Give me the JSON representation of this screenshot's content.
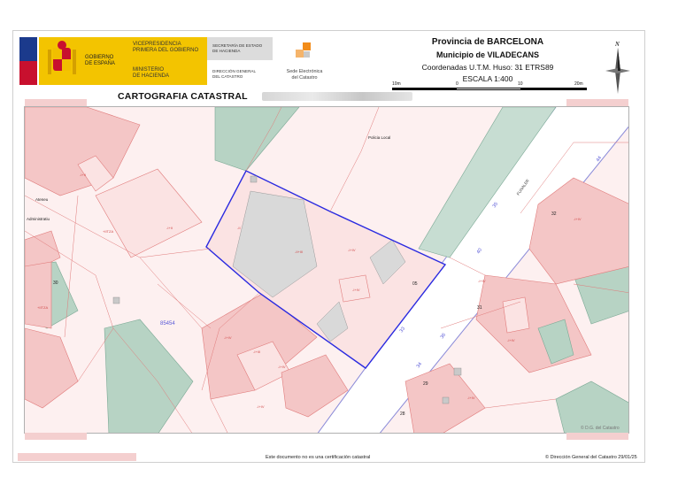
{
  "header": {
    "gov_label": "GOBIERNO\nDE ESPAÑA",
    "vice_label": "VICEPRESIDENCIA\nPRIMERA DEL GOBIERNO",
    "ministry_label": "MINISTERIO\nDE HACIENDA",
    "secretaria_label": "SECRETARÍA DE ESTADO\nDE HACIENDA",
    "direccion_label": "DIRECCIÓN GENERAL\nDEL CATASTRO",
    "sede_label": "Sede Electrónica\ndel Catastro",
    "province": "Provincia de BARCELONA",
    "municipality": "Municipio de VILADECANS",
    "coordinates": "Coordenadas U.T.M. Huso: 31 ETRS89",
    "scale": "ESCALA 1:400",
    "scale_ticks": [
      "10m",
      "0",
      "10",
      "20m"
    ],
    "north_label": "N",
    "map_title": "CARTOGRAFIA CATASTRAL"
  },
  "map": {
    "labels": [
      {
        "text": "Policia Local",
        "kind": "place"
      },
      {
        "text": "Ateneu",
        "kind": "place"
      },
      {
        "text": "Administratiu",
        "kind": "place"
      },
      {
        "text": "85454",
        "kind": "parcel-id"
      },
      {
        "text": "05",
        "kind": "number"
      },
      {
        "text": "30",
        "kind": "number"
      },
      {
        "text": "31",
        "kind": "number"
      },
      {
        "text": "32",
        "kind": "number"
      },
      {
        "text": "28",
        "kind": "number"
      },
      {
        "text": "29",
        "kind": "number"
      },
      {
        "text": "35",
        "kind": "street-number"
      },
      {
        "text": "33",
        "kind": "street-number"
      },
      {
        "text": "34",
        "kind": "street-number"
      },
      {
        "text": "40",
        "kind": "street-number"
      },
      {
        "text": "36",
        "kind": "street-number"
      },
      {
        "text": "44",
        "kind": "street-number"
      },
      {
        "text": "FUNALER",
        "kind": "street"
      },
      {
        "text": "-I+II",
        "kind": "floors"
      },
      {
        "text": "-I+II",
        "kind": "floors"
      },
      {
        "text": "-II",
        "kind": "floors"
      },
      {
        "text": "-II+III",
        "kind": "floors"
      },
      {
        "text": "-I+IV",
        "kind": "floors"
      },
      {
        "text": "-I+IV",
        "kind": "floors"
      },
      {
        "text": "-I+III",
        "kind": "floors"
      },
      {
        "text": "-I+IV",
        "kind": "floors"
      },
      {
        "text": "-I+IV",
        "kind": "floors"
      },
      {
        "text": "+IITZA",
        "kind": "floors"
      },
      {
        "text": "+IITZA",
        "kind": "floors"
      },
      {
        "text": "-I+IV",
        "kind": "floors"
      },
      {
        "text": "-I+IV",
        "kind": "floors"
      },
      {
        "text": "-I+IV",
        "kind": "floors"
      },
      {
        "text": "-I+IV",
        "kind": "floors"
      },
      {
        "text": "-I+IV",
        "kind": "floors"
      },
      {
        "text": "© D.G. del Catastro",
        "kind": "credit"
      }
    ]
  },
  "footer": {
    "center_text": "Este documento no es una certificación catastral",
    "right_text": "© Dirección General del Catastro 29/01/25"
  },
  "colors": {
    "parcel_pink": "#fbe3e3",
    "building_pink": "#f4c6c6",
    "green": "#b7d3c4",
    "grey": "#d9d9d9",
    "boundary_red": "#e07a7a",
    "highlight_blue": "#2a2ae0",
    "street_blue": "#6a6ad8"
  }
}
